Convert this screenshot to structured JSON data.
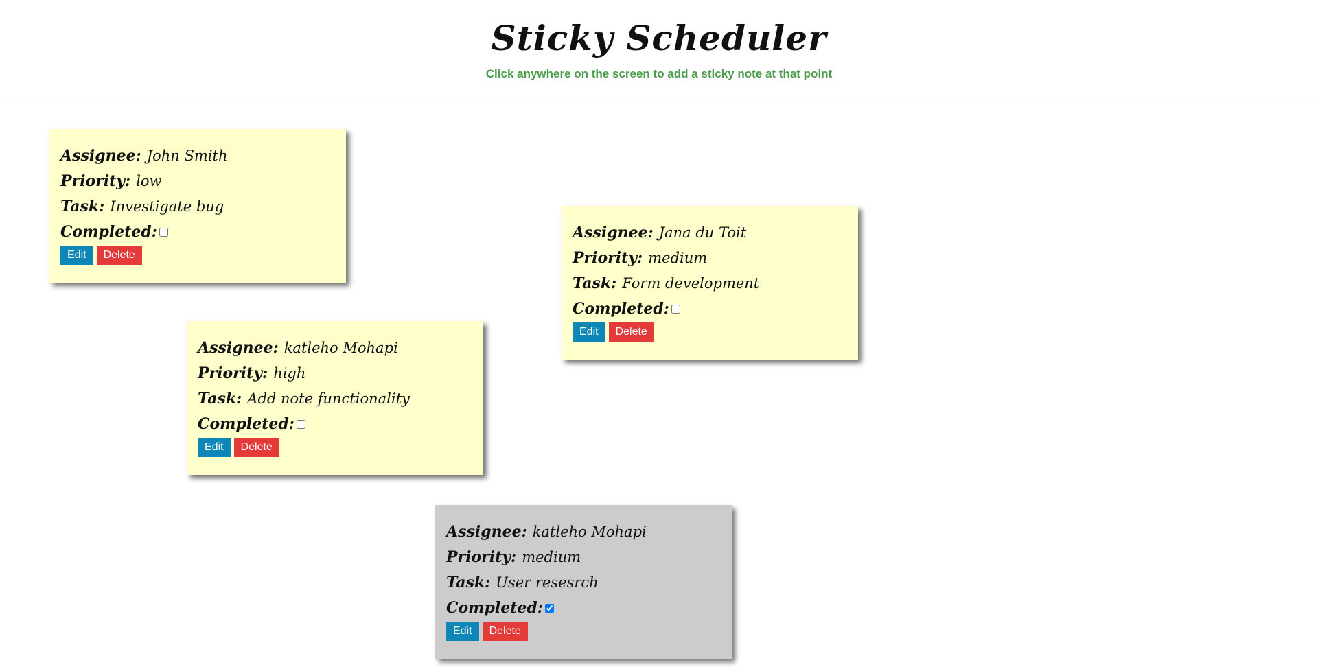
{
  "header": {
    "title": "Sticky Scheduler",
    "subtitle": "Click anywhere on the screen to add a sticky note at that point"
  },
  "labels": {
    "assignee": "Assignee:",
    "priority": "Priority:",
    "task": "Task:",
    "completed": "Completed:",
    "edit": "Edit",
    "delete": "Delete"
  },
  "colors": {
    "note": "#ffffcc",
    "note_completed": "#cccccc",
    "edit_button": "#0e86b8",
    "delete_button": "#e53a3a",
    "subtitle": "#4a9e4a"
  },
  "notes": [
    {
      "assignee": "John Smith",
      "priority": "low",
      "task": "Investigate bug",
      "completed": false
    },
    {
      "assignee": "Jana du Toit",
      "priority": "medium",
      "task": "Form development",
      "completed": false
    },
    {
      "assignee": "katleho Mohapi",
      "priority": "high",
      "task": "Add note functionality",
      "completed": false
    },
    {
      "assignee": "katleho Mohapi",
      "priority": "medium",
      "task": "User resesrch",
      "completed": true
    }
  ]
}
